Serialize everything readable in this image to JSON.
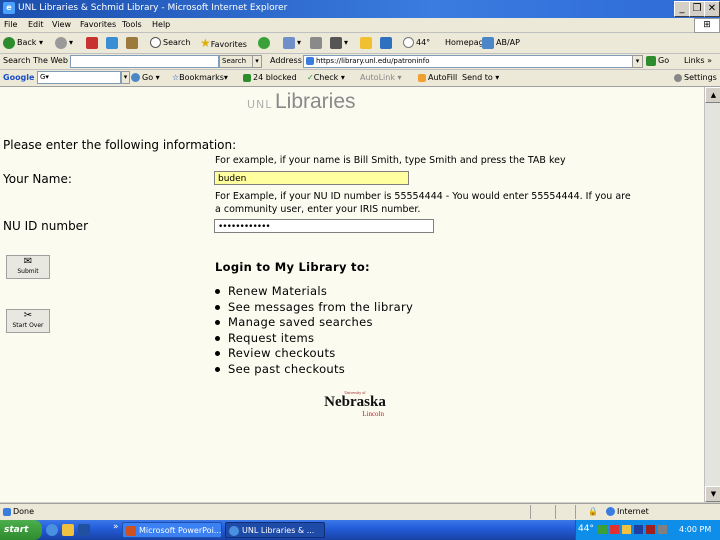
{
  "window": {
    "title": "UNL Libraries & Schmid Library - Microsoft Internet Explorer"
  },
  "menu": [
    "File",
    "Edit",
    "View",
    "Favorites",
    "Tools",
    "Help"
  ],
  "toolbar": {
    "back": "Back",
    "search": "Search",
    "favorites": "Favorites",
    "weather": "44°",
    "homepage": "Homepage",
    "news": "AB/AP"
  },
  "address": {
    "search_web_label": "Search The Web",
    "search_button": "Search",
    "address_label": "Address",
    "url": "https://library.unl.edu/patroninfo",
    "go": "Go",
    "links": "Links"
  },
  "google": {
    "label": "Google",
    "go": "Go",
    "bookmarks": "Bookmarks",
    "blocked": "24 blocked",
    "check": "Check",
    "autolink": "AutoLink",
    "autofill": "AutoFill",
    "send_to": "Send to",
    "settings": "Settings"
  },
  "page": {
    "logo_prefix": "UNL",
    "logo_main": "Libraries",
    "instructions": "Please enter the following information:",
    "name_hint": "For example, if your name is Bill Smith, type Smith and press the TAB key",
    "name_label": "Your Name:",
    "name_value": "buden",
    "id_hint_1": "For Example, if your NU ID number is 55554444 - You would enter 55554444. If you are",
    "id_hint_2": "a community user, enter your IRIS number.",
    "id_label": "NU ID number",
    "id_value": "••••••••••••",
    "submit_label": "Submit",
    "start_over_label": "Start Over",
    "login_heading": "Login to My Library to:",
    "features": [
      "Renew Materials",
      "See messages from the library",
      "Manage saved searches",
      "Request items",
      "Review checkouts",
      "See past checkouts"
    ],
    "footer_logo": "Nebraska",
    "footer_logo_sub": "Lincoln",
    "footer_logo_top": "University of"
  },
  "status": {
    "text": "Done",
    "zone": "Internet"
  },
  "taskbar": {
    "start": "start",
    "task1": "Microsoft PowerPoi...",
    "task2": "UNL Libraries & ...",
    "weather": "44°",
    "clock": "4:00 PM"
  }
}
